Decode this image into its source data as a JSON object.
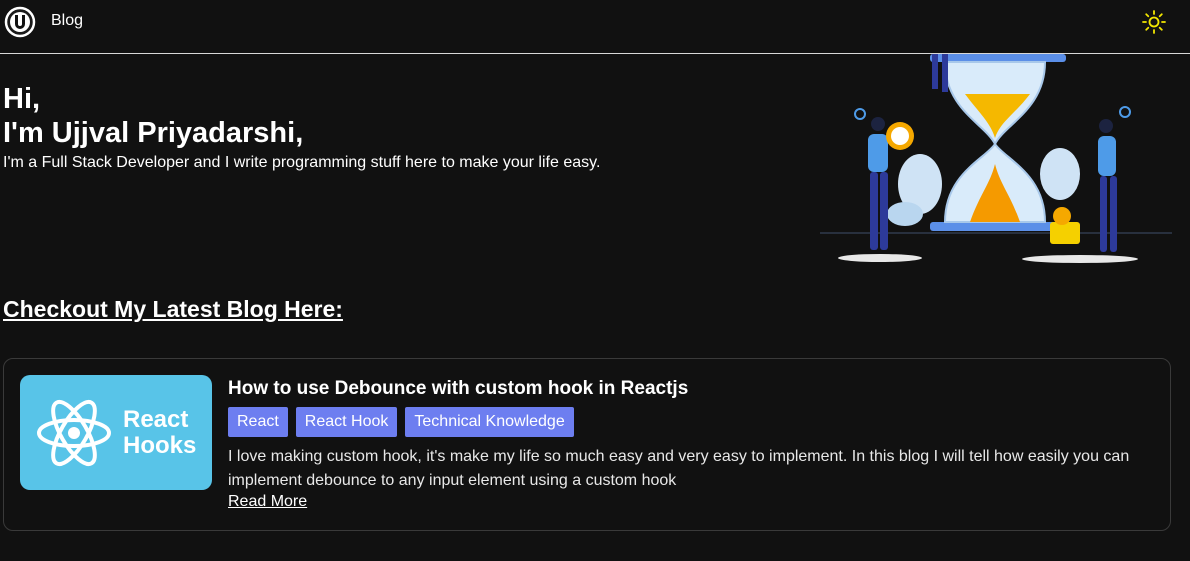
{
  "nav": {
    "blog_label": "Blog",
    "logo_icon": "u-logo-icon",
    "theme_icon": "sun-icon",
    "theme_icon_color": "#f2e600"
  },
  "hero": {
    "greeting": "Hi,",
    "name": "I'm Ujjval Priyadarshi,",
    "tagline": "I'm a Full Stack Developer and I write programming stuff here to make your life easy."
  },
  "section": {
    "title": "Checkout My Latest Blog Here:"
  },
  "blog": {
    "thumbnail_text_1": "React",
    "thumbnail_text_2": "Hooks",
    "thumbnail_icon": "react-atom-icon",
    "thumbnail_color": "#58c4e8",
    "title": "How to use Debounce with custom hook in Reactjs",
    "tags": [
      "React",
      "React Hook",
      "Technical Knowledge"
    ],
    "tag_color": "#6d7ef0",
    "description": "I love making custom hook, it's make my life so much easy and very easy to implement. In this blog I will tell how easily you can implement debounce to any input element using a custom hook",
    "read_more": "Read More"
  }
}
